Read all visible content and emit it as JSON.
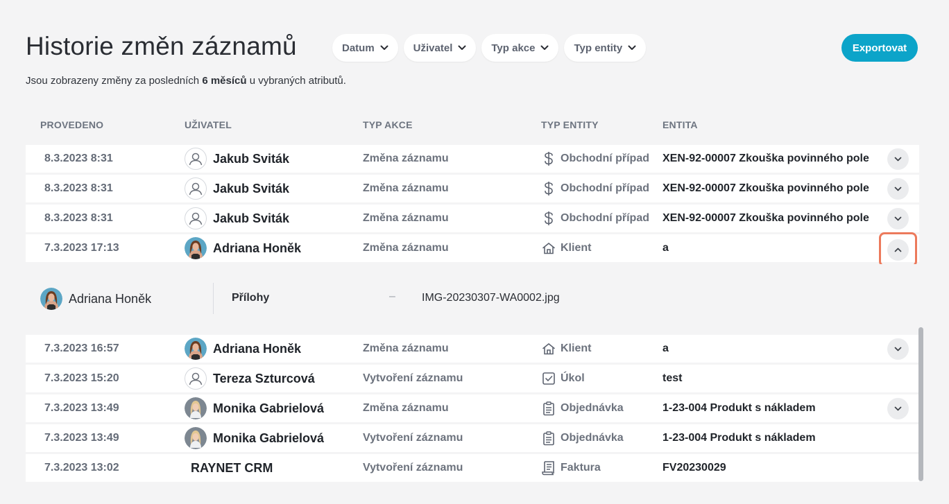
{
  "page": {
    "title": "Historie změn záznamů",
    "subtitle_pre": "Jsou zobrazeny změny za posledních ",
    "subtitle_bold": "6 měsíců",
    "subtitle_post": " u vybraných atributů."
  },
  "filters": [
    {
      "label": "Datum"
    },
    {
      "label": "Uživatel"
    },
    {
      "label": "Typ akce"
    },
    {
      "label": "Typ entity"
    }
  ],
  "export_label": "Exportovat",
  "colors": {
    "accent": "#0ca4c9",
    "highlight": "#ec7a5c"
  },
  "columns": {
    "date": "PROVEDENO",
    "user": "UŽIVATEL",
    "action": "TYP AKCE",
    "type": "TYP ENTITY",
    "entity": "ENTITA"
  },
  "rows": [
    {
      "date": "8.3.2023 8:31",
      "user": "Jakub Sviták",
      "avatar": "generic",
      "action": "Změna záznamu",
      "type": "Obchodní případ",
      "type_icon": "dollar-icon",
      "entity": "XEN-92-00007 Zkouška povinného pole",
      "expand": "collapsed"
    },
    {
      "date": "8.3.2023 8:31",
      "user": "Jakub Sviták",
      "avatar": "generic",
      "action": "Změna záznamu",
      "type": "Obchodní případ",
      "type_icon": "dollar-icon",
      "entity": "XEN-92-00007 Zkouška povinného pole",
      "expand": "collapsed"
    },
    {
      "date": "8.3.2023 8:31",
      "user": "Jakub Sviták",
      "avatar": "generic",
      "action": "Změna záznamu",
      "type": "Obchodní případ",
      "type_icon": "dollar-icon",
      "entity": "XEN-92-00007 Zkouška povinného pole",
      "expand": "collapsed"
    },
    {
      "date": "7.3.2023 17:13",
      "user": "Adriana Honěk",
      "avatar": "photo-adriana",
      "action": "Změna záznamu",
      "type": "Klient",
      "type_icon": "house-icon",
      "entity": "a",
      "expand": "expanded"
    },
    {
      "date": "7.3.2023 16:57",
      "user": "Adriana Honěk",
      "avatar": "photo-adriana",
      "action": "Změna záznamu",
      "type": "Klient",
      "type_icon": "house-icon",
      "entity": "a",
      "expand": "collapsed"
    },
    {
      "date": "7.3.2023 15:20",
      "user": "Tereza Szturcová",
      "avatar": "generic",
      "action": "Vytvoření záznamu",
      "type": "Úkol",
      "type_icon": "checkbox-icon",
      "entity": "test",
      "expand": "none"
    },
    {
      "date": "7.3.2023 13:49",
      "user": "Monika Gabrielová",
      "avatar": "photo-monika",
      "action": "Změna záznamu",
      "type": "Objednávka",
      "type_icon": "clipboard-icon",
      "entity": "1-23-004 Produkt s nákladem",
      "expand": "collapsed"
    },
    {
      "date": "7.3.2023 13:49",
      "user": "Monika Gabrielová",
      "avatar": "photo-monika",
      "action": "Vytvoření záznamu",
      "type": "Objednávka",
      "type_icon": "clipboard-icon",
      "entity": "1-23-004 Produkt s nákladem",
      "expand": "none"
    },
    {
      "date": "7.3.2023 13:02",
      "user": "RAYNET CRM",
      "avatar": "none",
      "action": "Vytvoření záznamu",
      "type": "Faktura",
      "type_icon": "receipt-icon",
      "entity": "FV20230029",
      "expand": "none"
    }
  ],
  "detail": {
    "user": "Adriana Honěk",
    "attribute": "Přílohy",
    "old_value": "–",
    "new_value": "IMG-20230307-WA0002.jpg"
  }
}
